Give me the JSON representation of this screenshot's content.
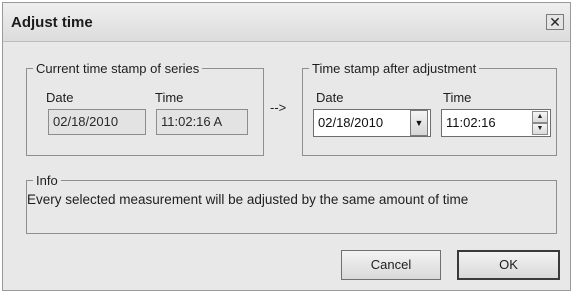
{
  "window": {
    "title": "Adjust time",
    "close_glyph": "✕",
    "close_icon": "close-icon"
  },
  "current": {
    "legend": "Current time stamp of series",
    "date_label": "Date",
    "time_label": "Time",
    "date_value": "02/18/2010",
    "time_value": "11:02:16 A"
  },
  "arrow": "-->",
  "adjusted": {
    "legend": "Time stamp after adjustment",
    "date_label": "Date",
    "time_label": "Time",
    "date_value": "02/18/2010",
    "time_value": "11:02:16",
    "dropdown_icon": "chevron-down-icon",
    "spin_up_icon": "spin-up-icon",
    "spin_down_icon": "spin-down-icon"
  },
  "info": {
    "legend": "Info",
    "text": "Every selected measurement will be adjusted by the same amount of time"
  },
  "buttons": {
    "cancel": "Cancel",
    "ok": "OK"
  }
}
